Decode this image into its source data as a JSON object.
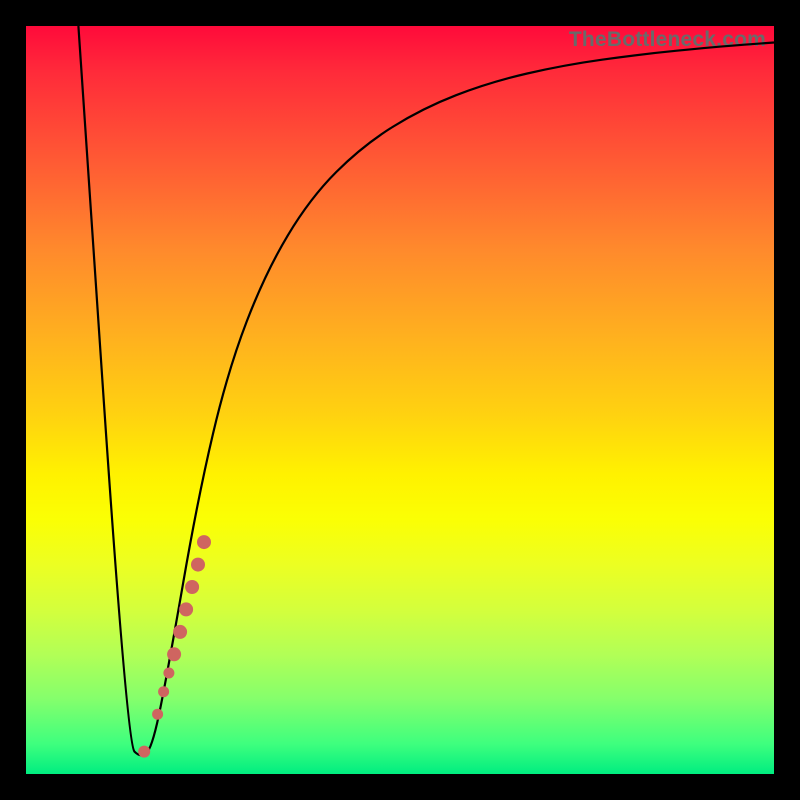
{
  "watermark": "TheBottleneck.com",
  "colors": {
    "frame": "#000000",
    "curve": "#000000",
    "dots": "#cf6560",
    "gradient_top": "#ff0a3a",
    "gradient_bottom": "#00ed80"
  },
  "chart_data": {
    "type": "line",
    "title": "",
    "xlabel": "",
    "ylabel": "",
    "xlim": [
      0,
      100
    ],
    "ylim": [
      0,
      100
    ],
    "series": [
      {
        "name": "curve",
        "x": [
          7,
          13.5,
          15.5,
          17,
          19,
          23,
          27,
          32,
          38,
          45,
          53,
          62,
          72,
          82,
          92,
          100
        ],
        "y": [
          100,
          4,
          2,
          4,
          14,
          37,
          54,
          67,
          77,
          84,
          89,
          92.5,
          94.8,
          96.2,
          97.2,
          97.8
        ]
      }
    ],
    "markers": [
      {
        "x": 15.8,
        "y": 3.0,
        "r": 6
      },
      {
        "x": 17.6,
        "y": 8.0,
        "r": 5.5
      },
      {
        "x": 18.4,
        "y": 11.0,
        "r": 5.5
      },
      {
        "x": 19.1,
        "y": 13.5,
        "r": 5.5
      },
      {
        "x": 19.8,
        "y": 16.0,
        "r": 7
      },
      {
        "x": 20.6,
        "y": 19.0,
        "r": 7
      },
      {
        "x": 21.4,
        "y": 22.0,
        "r": 7
      },
      {
        "x": 22.2,
        "y": 25.0,
        "r": 7
      },
      {
        "x": 23.0,
        "y": 28.0,
        "r": 7
      },
      {
        "x": 23.8,
        "y": 31.0,
        "r": 7
      }
    ]
  }
}
